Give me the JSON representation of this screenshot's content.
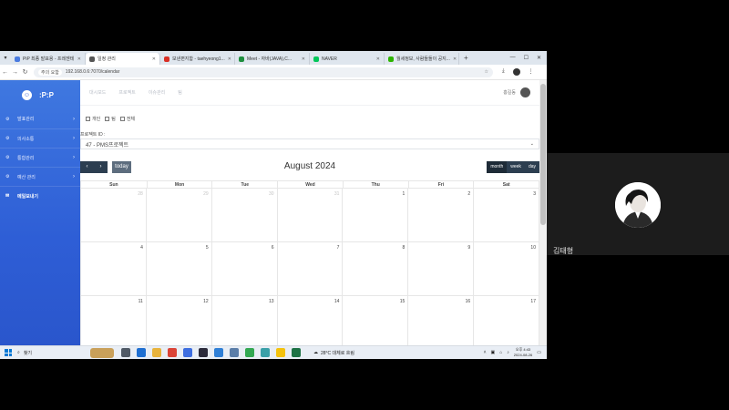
{
  "browser": {
    "tabs": [
      {
        "label": "PiP 최종 발표용 - 프레젠테",
        "favicon_color": "#4a7be0"
      },
      {
        "label": "일정 관리",
        "favicon_color": "#555555",
        "active": true
      },
      {
        "label": "보낸편지함 - taehyeong1...",
        "favicon_color": "#d93025"
      },
      {
        "label": "Meet - 자바(JAVA),C...",
        "favicon_color": "#1e8e3e"
      },
      {
        "label": "NAVER",
        "favicon_color": "#03c75a"
      },
      {
        "label": "월세정보, 사람들돌이 공지...",
        "favicon_color": "#2db400"
      }
    ],
    "secure_label": "주의 요함",
    "url": "192.168.0.6:7070/calendar"
  },
  "app": {
    "brand_name": ":P:P",
    "sidebar": [
      {
        "label": "발표관리",
        "icon": "gear-icon",
        "chevron": true
      },
      {
        "label": "의사소통",
        "icon": "gear-icon",
        "chevron": true
      },
      {
        "label": "통합관리",
        "icon": "gear-icon",
        "chevron": true
      },
      {
        "label": "예산 관리",
        "icon": "gear-icon",
        "chevron": true
      },
      {
        "label": "메일보내기",
        "icon": "mail-icon",
        "chevron": false,
        "active": true
      }
    ],
    "topnav": [
      "대시보드",
      "프로젝트",
      "이슈관리",
      "팀"
    ],
    "user_name": "홍길동",
    "filters": [
      {
        "label": "개인",
        "checked": false
      },
      {
        "label": "팀",
        "checked": false
      },
      {
        "label": "전체",
        "checked": false
      }
    ],
    "project_label": "프로젝트 ID :",
    "project_value": "47 - PMS프로젝트",
    "calendar": {
      "title": "August 2024",
      "today_label": "today",
      "views": [
        "month",
        "week",
        "day"
      ],
      "active_view": "month",
      "weekdays": [
        "Sun",
        "Mon",
        "Tue",
        "Wed",
        "Thu",
        "Fri",
        "Sat"
      ],
      "weeks": [
        [
          {
            "d": "28",
            "o": true
          },
          {
            "d": "29",
            "o": true
          },
          {
            "d": "30",
            "o": true
          },
          {
            "d": "31",
            "o": true
          },
          {
            "d": "1"
          },
          {
            "d": "2"
          },
          {
            "d": "3"
          }
        ],
        [
          {
            "d": "4"
          },
          {
            "d": "5"
          },
          {
            "d": "6"
          },
          {
            "d": "7"
          },
          {
            "d": "8"
          },
          {
            "d": "9"
          },
          {
            "d": "10"
          }
        ],
        [
          {
            "d": "11"
          },
          {
            "d": "12"
          },
          {
            "d": "13"
          },
          {
            "d": "14"
          },
          {
            "d": "15"
          },
          {
            "d": "16"
          },
          {
            "d": "17"
          }
        ]
      ]
    }
  },
  "taskbar": {
    "search_label": "찾기",
    "weather": "28°C 대체로 흐림",
    "time": "오후 4:43",
    "date": "2024-08-26"
  },
  "meeting": {
    "participant_name": "김태형"
  }
}
